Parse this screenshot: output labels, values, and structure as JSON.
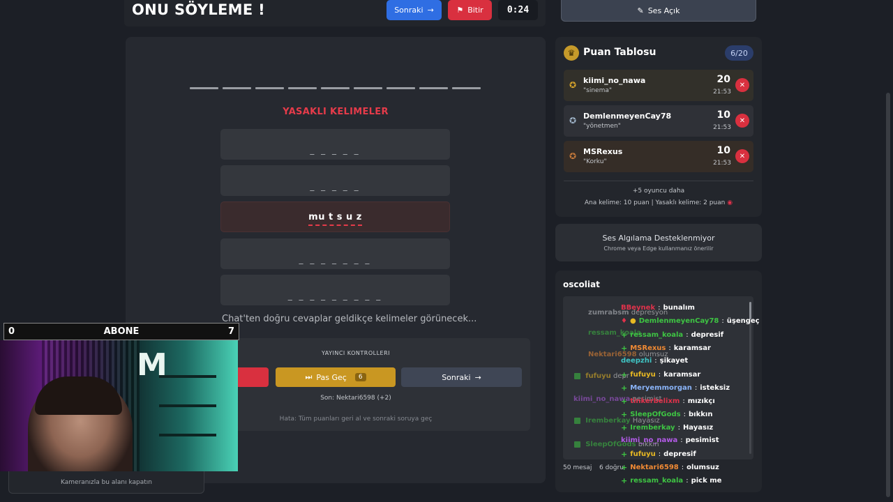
{
  "header": {
    "title": "ONU SÖYLEME !",
    "next_label": "Sonraki",
    "finish_label": "Bitir",
    "timer": "0:24"
  },
  "game": {
    "blank_count": 9,
    "taboo_title": "YASAKLI KELIMELER",
    "taboo_cards": [
      {
        "text": "_ _ _ _ _",
        "revealed": false
      },
      {
        "text": "_ _ _ _ _",
        "revealed": false
      },
      {
        "text": "mu t s u z",
        "revealed": true
      },
      {
        "text": "_ _ _ _ _ _ _",
        "revealed": false
      },
      {
        "text": "_ _ _ _ _ _ _ _ _",
        "revealed": false
      }
    ],
    "chat_hint": "Chat'ten doğru cevaplar geldikçe kelimeler görünecek..."
  },
  "controls": {
    "title": "YAYINCI KONTROLLERI",
    "pass_label": "Pas Geç",
    "pass_count": "6",
    "next_label": "Sonraki",
    "last_info": "Son: Nektari6598 (+2)",
    "error_hint": "Hata: Tüm puanları geri al ve sonraki soruya geç"
  },
  "webcam": {
    "left_count": "0",
    "label": "ABONE",
    "right_count": "7",
    "caption": "Kameranızla bu alanı kapatın"
  },
  "sound": {
    "label": "Ses Açık"
  },
  "scoreboard": {
    "title": "Puan Tablosu",
    "count": "6/20",
    "players": [
      {
        "name": "kiimi_no_nawa",
        "guess": "\"sinema\"",
        "score": "20",
        "time": "21:53",
        "medal": "gold"
      },
      {
        "name": "DemlenmeyenCay78",
        "guess": "\"yönetmen\"",
        "score": "10",
        "time": "21:53",
        "medal": "silver"
      },
      {
        "name": "MSRexus",
        "guess": "\"Korku\"",
        "score": "10",
        "time": "21:53",
        "medal": "bronze"
      }
    ],
    "more": "+5 oyuncu daha",
    "points": "Ana kelime: 10 puan | Yasaklı kelime: 2 puan"
  },
  "voice": {
    "title": "Ses Algılama Desteklenmiyor",
    "sub": "Chrome veya Edge kullanmanız önerilir"
  },
  "chat": {
    "channel": "oscoliat",
    "message_count": "50 mesaj",
    "correct_count": "6 doğru",
    "messages": [
      {
        "user": "BBeynek",
        "msg": "bunalım",
        "color": "#e0324b"
      },
      {
        "user": "DemlenmeyenCay78",
        "msg": "üşengeç",
        "color": "#3ec443"
      },
      {
        "user": "ressam_koala",
        "msg": "depresif",
        "color": "#3ec443"
      },
      {
        "user": "MSRexus",
        "msg": "karamsar",
        "color": "#f08a34"
      },
      {
        "user": "deepzhi",
        "msg": "şikayet",
        "color": "#3fc4c4"
      },
      {
        "user": "fufuyu",
        "msg": "karamsar",
        "color": "#e8b923"
      },
      {
        "user": "Meryemmorgan",
        "msg": "isteksiz",
        "color": "#8ab4f8"
      },
      {
        "user": "tinkerbelixm",
        "msg": "mızıkçı",
        "color": "#e0324b"
      },
      {
        "user": "SleepOfGods",
        "msg": "bıkkın",
        "color": "#3ec443"
      },
      {
        "user": "Iremberkay",
        "msg": "Hayasız",
        "color": "#3ec443"
      },
      {
        "user": "kiimi_no_nawa",
        "msg": "pesimist",
        "color": "#b35be8"
      },
      {
        "user": "fufuyu",
        "msg": "depresif",
        "color": "#e8b923"
      },
      {
        "user": "Nektari6598",
        "msg": "olumsuz",
        "color": "#f08a34"
      },
      {
        "user": "ressam_koala",
        "msg": "pick me",
        "color": "#3ec443"
      }
    ],
    "ghost_lines": [
      {
        "user": "zumrabsm",
        "msg": "depresyon",
        "color": "#c4c7cc"
      },
      {
        "user": "ressam_koala",
        "msg": "",
        "color": "#3ec443"
      },
      {
        "user": "Nektari6598",
        "msg": "olumsuz",
        "color": "#f08a34"
      },
      {
        "user": "fufuyu",
        "msg": "depr",
        "color": "#e8b923"
      },
      {
        "user": "kiimi_no_nawa",
        "msg": "pesimist",
        "color": "#b35be8"
      },
      {
        "user": "Iremberkay",
        "msg": "Hayasız",
        "color": "#3ec443"
      },
      {
        "user": "SleepOfGods",
        "msg": "bıkkın",
        "color": "#3ec443"
      }
    ]
  }
}
